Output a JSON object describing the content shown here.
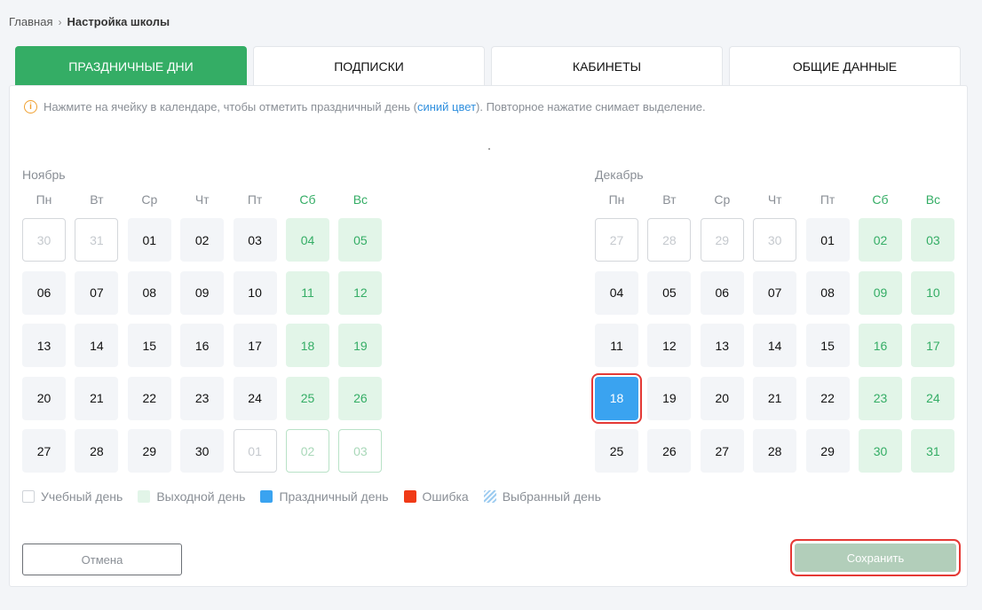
{
  "breadcrumb": {
    "home": "Главная",
    "current": "Настройка школы"
  },
  "tabs": [
    {
      "label": "ПРАЗДНИЧНЫЕ ДНИ",
      "active": true
    },
    {
      "label": "ПОДПИСКИ",
      "active": false
    },
    {
      "label": "КАБИНЕТЫ",
      "active": false
    },
    {
      "label": "ОБЩИЕ ДАННЫЕ",
      "active": false
    }
  ],
  "hint": {
    "before": "Нажмите на ячейку в календаре, чтобы отметить праздничный день (",
    "blue": "синий цвет",
    "after": "). Повторное нажатие снимает выделение."
  },
  "weekdays": [
    "Пн",
    "Вт",
    "Ср",
    "Чт",
    "Пт",
    "Сб",
    "Вс"
  ],
  "months": [
    {
      "name": "Ноябрь",
      "weeks": [
        [
          "30",
          "31",
          "01",
          "02",
          "03",
          "04",
          "05"
        ],
        [
          "06",
          "07",
          "08",
          "09",
          "10",
          "11",
          "12"
        ],
        [
          "13",
          "14",
          "15",
          "16",
          "17",
          "18",
          "19"
        ],
        [
          "20",
          "21",
          "22",
          "23",
          "24",
          "25",
          "26"
        ],
        [
          "27",
          "28",
          "29",
          "30",
          "01",
          "02",
          "03"
        ]
      ],
      "other_month": [
        [
          0,
          0
        ],
        [
          0,
          1
        ],
        [
          4,
          4
        ],
        [
          4,
          5
        ],
        [
          4,
          6
        ]
      ],
      "holidays": []
    },
    {
      "name": "Декабрь",
      "weeks": [
        [
          "27",
          "28",
          "29",
          "30",
          "01",
          "02",
          "03"
        ],
        [
          "04",
          "05",
          "06",
          "07",
          "08",
          "09",
          "10"
        ],
        [
          "11",
          "12",
          "13",
          "14",
          "15",
          "16",
          "17"
        ],
        [
          "18",
          "19",
          "20",
          "21",
          "22",
          "23",
          "24"
        ],
        [
          "25",
          "26",
          "27",
          "28",
          "29",
          "30",
          "31"
        ]
      ],
      "other_month": [
        [
          0,
          0
        ],
        [
          0,
          1
        ],
        [
          0,
          2
        ],
        [
          0,
          3
        ]
      ],
      "holidays": [
        [
          3,
          0
        ]
      ]
    }
  ],
  "legend": [
    "Учебный день",
    "Выходной день",
    "Праздничный день",
    "Ошибка",
    "Выбранный день"
  ],
  "buttons": {
    "cancel": "Отмена",
    "save": "Сохранить"
  },
  "colors": {
    "accent": "#34ad65",
    "weekend_bg": "#e2f5e8",
    "holiday": "#3aa3f0",
    "error": "#f03a17",
    "save_disabled": "#b2ceba"
  }
}
